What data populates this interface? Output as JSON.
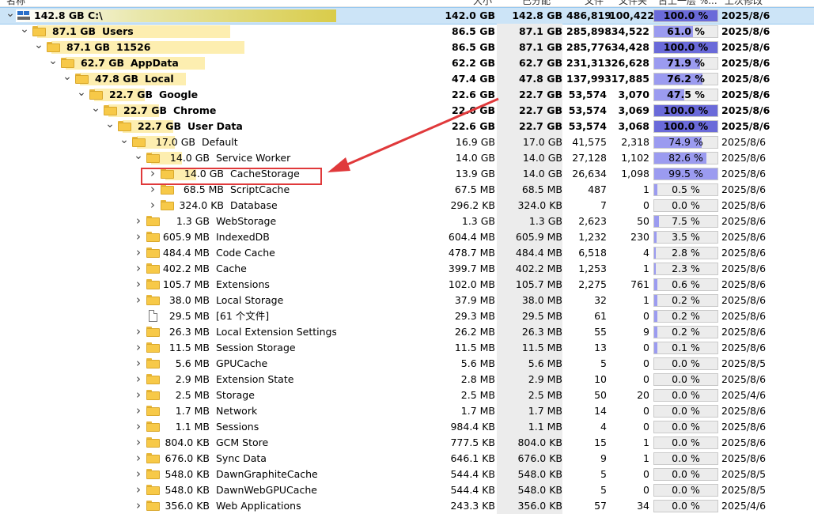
{
  "header": {
    "name": "名称",
    "size": "大小",
    "allocated": "已分配",
    "files": "文件",
    "folders": "文件夹",
    "percent_of_parent": "占上一层 %...",
    "last_modified": "上次修改"
  },
  "rows": [
    {
      "level": 0,
      "chevron": "down",
      "icon": "drive",
      "tree_size": "142.8 GB",
      "name": "C:\\",
      "bold": true,
      "bar": 1.0,
      "root": true,
      "selected": true,
      "size": "142.0 GB",
      "alloc": "142.8 GB",
      "files": "486,819",
      "folders": "100,422",
      "pct": "100.0 %",
      "pct_value": 100.0,
      "date": "2025/8/6"
    },
    {
      "level": 1,
      "chevron": "down",
      "icon": "folder",
      "tree_size": "87.1 GB",
      "name": "Users",
      "bold": true,
      "bar": 0.61,
      "size": "86.5 GB",
      "alloc": "87.1 GB",
      "files": "285,898",
      "folders": "34,522",
      "pct": "61.0 %",
      "pct_value": 61.0,
      "date": "2025/8/6"
    },
    {
      "level": 2,
      "chevron": "down",
      "icon": "folder",
      "tree_size": "87.1 GB",
      "name": "11526",
      "bold": true,
      "bar": 0.61,
      "size": "86.5 GB",
      "alloc": "87.1 GB",
      "files": "285,776",
      "folders": "34,428",
      "pct": "100.0 %",
      "pct_value": 100.0,
      "date": "2025/8/6"
    },
    {
      "level": 3,
      "chevron": "down",
      "icon": "folder",
      "tree_size": "62.7 GB",
      "name": "AppData",
      "bold": true,
      "bar": 0.44,
      "size": "62.2 GB",
      "alloc": "62.7 GB",
      "files": "231,313",
      "folders": "26,628",
      "pct": "71.9 %",
      "pct_value": 71.9,
      "date": "2025/8/6"
    },
    {
      "level": 4,
      "chevron": "down",
      "icon": "folder",
      "tree_size": "47.8 GB",
      "name": "Local",
      "bold": true,
      "bar": 0.335,
      "size": "47.4 GB",
      "alloc": "47.8 GB",
      "files": "137,993",
      "folders": "17,885",
      "pct": "76.2 %",
      "pct_value": 76.2,
      "date": "2025/8/6"
    },
    {
      "level": 5,
      "chevron": "down",
      "icon": "folder",
      "tree_size": "22.7 GB",
      "name": "Google",
      "bold": true,
      "bar": 0.16,
      "size": "22.6 GB",
      "alloc": "22.7 GB",
      "files": "53,574",
      "folders": "3,070",
      "pct": "47.5 %",
      "pct_value": 47.5,
      "date": "2025/8/6"
    },
    {
      "level": 6,
      "chevron": "down",
      "icon": "folder",
      "tree_size": "22.7 GB",
      "name": "Chrome",
      "bold": true,
      "bar": 0.16,
      "size": "22.6 GB",
      "alloc": "22.7 GB",
      "files": "53,574",
      "folders": "3,069",
      "pct": "100.0 %",
      "pct_value": 100.0,
      "date": "2025/8/6"
    },
    {
      "level": 7,
      "chevron": "down",
      "icon": "folder",
      "tree_size": "22.7 GB",
      "name": "User Data",
      "bold": true,
      "bar": 0.16,
      "size": "22.6 GB",
      "alloc": "22.7 GB",
      "files": "53,574",
      "folders": "3,068",
      "pct": "100.0 %",
      "pct_value": 100.0,
      "date": "2025/8/6"
    },
    {
      "level": 8,
      "chevron": "down",
      "icon": "folder",
      "tree_size": "17.0 GB",
      "name": "Default",
      "bold": false,
      "bar": 0.12,
      "size": "16.9 GB",
      "alloc": "17.0 GB",
      "files": "41,575",
      "folders": "2,318",
      "pct": "74.9 %",
      "pct_value": 74.9,
      "date": "2025/8/6"
    },
    {
      "level": 9,
      "chevron": "down",
      "icon": "folder",
      "tree_size": "14.0 GB",
      "name": "Service Worker",
      "bold": false,
      "bar": 0.098,
      "size": "14.0 GB",
      "alloc": "14.0 GB",
      "files": "27,128",
      "folders": "1,102",
      "pct": "82.6 %",
      "pct_value": 82.6,
      "date": "2025/8/6"
    },
    {
      "level": 10,
      "chevron": "right",
      "icon": "folder",
      "tree_size": "14.0 GB",
      "name": "CacheStorage",
      "bold": false,
      "bar": 0.098,
      "size": "13.9 GB",
      "alloc": "14.0 GB",
      "files": "26,634",
      "folders": "1,098",
      "pct": "99.5 %",
      "pct_value": 99.5,
      "date": "2025/8/6"
    },
    {
      "level": 10,
      "chevron": "right",
      "icon": "folder",
      "tree_size": "68.5 MB",
      "name": "ScriptCache",
      "bold": false,
      "bar": 0.0,
      "size": "67.5 MB",
      "alloc": "68.5 MB",
      "files": "487",
      "folders": "1",
      "pct": "0.5 %",
      "pct_value": 0.5,
      "date": "2025/8/6"
    },
    {
      "level": 10,
      "chevron": "right",
      "icon": "folder",
      "tree_size": "324.0 KB",
      "name": "Database",
      "bold": false,
      "bar": 0.0,
      "size": "296.2 KB",
      "alloc": "324.0 KB",
      "files": "7",
      "folders": "0",
      "pct": "0.0 %",
      "pct_value": 0.0,
      "date": "2025/8/6"
    },
    {
      "level": 9,
      "chevron": "right",
      "icon": "folder",
      "tree_size": "1.3 GB",
      "name": "WebStorage",
      "bold": false,
      "bar": 0.0,
      "size": "1.3 GB",
      "alloc": "1.3 GB",
      "files": "2,623",
      "folders": "50",
      "pct": "7.5 %",
      "pct_value": 7.5,
      "date": "2025/8/6"
    },
    {
      "level": 9,
      "chevron": "right",
      "icon": "folder",
      "tree_size": "605.9 MB",
      "name": "IndexedDB",
      "bold": false,
      "bar": 0.0,
      "size": "604.4 MB",
      "alloc": "605.9 MB",
      "files": "1,232",
      "folders": "230",
      "pct": "3.5 %",
      "pct_value": 3.5,
      "date": "2025/8/6"
    },
    {
      "level": 9,
      "chevron": "right",
      "icon": "folder",
      "tree_size": "484.4 MB",
      "name": "Code Cache",
      "bold": false,
      "bar": 0.0,
      "size": "478.7 MB",
      "alloc": "484.4 MB",
      "files": "6,518",
      "folders": "4",
      "pct": "2.8 %",
      "pct_value": 2.8,
      "date": "2025/8/6"
    },
    {
      "level": 9,
      "chevron": "right",
      "icon": "folder",
      "tree_size": "402.2 MB",
      "name": "Cache",
      "bold": false,
      "bar": 0.0,
      "size": "399.7 MB",
      "alloc": "402.2 MB",
      "files": "1,253",
      "folders": "1",
      "pct": "2.3 %",
      "pct_value": 2.3,
      "date": "2025/8/6"
    },
    {
      "level": 9,
      "chevron": "right",
      "icon": "folder",
      "tree_size": "105.7 MB",
      "name": "Extensions",
      "bold": false,
      "bar": 0.0,
      "size": "102.0 MB",
      "alloc": "105.7 MB",
      "files": "2,275",
      "folders": "761",
      "pct": "0.6 %",
      "pct_value": 0.6,
      "date": "2025/8/6"
    },
    {
      "level": 9,
      "chevron": "right",
      "icon": "folder",
      "tree_size": "38.0 MB",
      "name": "Local Storage",
      "bold": false,
      "bar": 0.0,
      "size": "37.9 MB",
      "alloc": "38.0 MB",
      "files": "32",
      "folders": "1",
      "pct": "0.2 %",
      "pct_value": 0.2,
      "date": "2025/8/6"
    },
    {
      "level": 9,
      "chevron": "none",
      "icon": "file",
      "tree_size": "29.5 MB",
      "name": "[61 个文件]",
      "bold": false,
      "bar": 0.0,
      "size": "29.3 MB",
      "alloc": "29.5 MB",
      "files": "61",
      "folders": "0",
      "pct": "0.2 %",
      "pct_value": 0.2,
      "date": "2025/8/6"
    },
    {
      "level": 9,
      "chevron": "right",
      "icon": "folder",
      "tree_size": "26.3 MB",
      "name": "Local Extension Settings",
      "bold": false,
      "bar": 0.0,
      "size": "26.2 MB",
      "alloc": "26.3 MB",
      "files": "55",
      "folders": "9",
      "pct": "0.2 %",
      "pct_value": 0.2,
      "date": "2025/8/6"
    },
    {
      "level": 9,
      "chevron": "right",
      "icon": "folder",
      "tree_size": "11.5 MB",
      "name": "Session Storage",
      "bold": false,
      "bar": 0.0,
      "size": "11.5 MB",
      "alloc": "11.5 MB",
      "files": "13",
      "folders": "0",
      "pct": "0.1 %",
      "pct_value": 0.1,
      "date": "2025/8/6"
    },
    {
      "level": 9,
      "chevron": "right",
      "icon": "folder",
      "tree_size": "5.6 MB",
      "name": "GPUCache",
      "bold": false,
      "bar": 0.0,
      "size": "5.6 MB",
      "alloc": "5.6 MB",
      "files": "5",
      "folders": "0",
      "pct": "0.0 %",
      "pct_value": 0.0,
      "date": "2025/8/5"
    },
    {
      "level": 9,
      "chevron": "right",
      "icon": "folder",
      "tree_size": "2.9 MB",
      "name": "Extension State",
      "bold": false,
      "bar": 0.0,
      "size": "2.8 MB",
      "alloc": "2.9 MB",
      "files": "10",
      "folders": "0",
      "pct": "0.0 %",
      "pct_value": 0.0,
      "date": "2025/8/6"
    },
    {
      "level": 9,
      "chevron": "right",
      "icon": "folder",
      "tree_size": "2.5 MB",
      "name": "Storage",
      "bold": false,
      "bar": 0.0,
      "size": "2.5 MB",
      "alloc": "2.5 MB",
      "files": "50",
      "folders": "20",
      "pct": "0.0 %",
      "pct_value": 0.0,
      "date": "2025/4/6"
    },
    {
      "level": 9,
      "chevron": "right",
      "icon": "folder",
      "tree_size": "1.7 MB",
      "name": "Network",
      "bold": false,
      "bar": 0.0,
      "size": "1.7 MB",
      "alloc": "1.7 MB",
      "files": "14",
      "folders": "0",
      "pct": "0.0 %",
      "pct_value": 0.0,
      "date": "2025/8/6"
    },
    {
      "level": 9,
      "chevron": "right",
      "icon": "folder",
      "tree_size": "1.1 MB",
      "name": "Sessions",
      "bold": false,
      "bar": 0.0,
      "size": "984.4 KB",
      "alloc": "1.1 MB",
      "files": "4",
      "folders": "0",
      "pct": "0.0 %",
      "pct_value": 0.0,
      "date": "2025/8/6"
    },
    {
      "level": 9,
      "chevron": "right",
      "icon": "folder",
      "tree_size": "804.0 KB",
      "name": "GCM Store",
      "bold": false,
      "bar": 0.0,
      "size": "777.5 KB",
      "alloc": "804.0 KB",
      "files": "15",
      "folders": "1",
      "pct": "0.0 %",
      "pct_value": 0.0,
      "date": "2025/8/6"
    },
    {
      "level": 9,
      "chevron": "right",
      "icon": "folder",
      "tree_size": "676.0 KB",
      "name": "Sync Data",
      "bold": false,
      "bar": 0.0,
      "size": "646.1 KB",
      "alloc": "676.0 KB",
      "files": "9",
      "folders": "1",
      "pct": "0.0 %",
      "pct_value": 0.0,
      "date": "2025/8/6"
    },
    {
      "level": 9,
      "chevron": "right",
      "icon": "folder",
      "tree_size": "548.0 KB",
      "name": "DawnGraphiteCache",
      "bold": false,
      "bar": 0.0,
      "size": "544.4 KB",
      "alloc": "548.0 KB",
      "files": "5",
      "folders": "0",
      "pct": "0.0 %",
      "pct_value": 0.0,
      "date": "2025/8/5"
    },
    {
      "level": 9,
      "chevron": "right",
      "icon": "folder",
      "tree_size": "548.0 KB",
      "name": "DawnWebGPUCache",
      "bold": false,
      "bar": 0.0,
      "size": "544.4 KB",
      "alloc": "548.0 KB",
      "files": "5",
      "folders": "0",
      "pct": "0.0 %",
      "pct_value": 0.0,
      "date": "2025/8/5"
    },
    {
      "level": 9,
      "chevron": "right",
      "icon": "folder",
      "tree_size": "356.0 KB",
      "name": "Web Applications",
      "bold": false,
      "bar": 0.0,
      "size": "243.3 KB",
      "alloc": "356.0 KB",
      "files": "57",
      "folders": "34",
      "pct": "0.0 %",
      "pct_value": 0.0,
      "date": "2025/4/6"
    }
  ],
  "colors": {
    "highlight_box": "#e0393b",
    "arrow": "#e0393b",
    "selection": "#cce4f7",
    "percent_bar": "#9b9bf0"
  }
}
